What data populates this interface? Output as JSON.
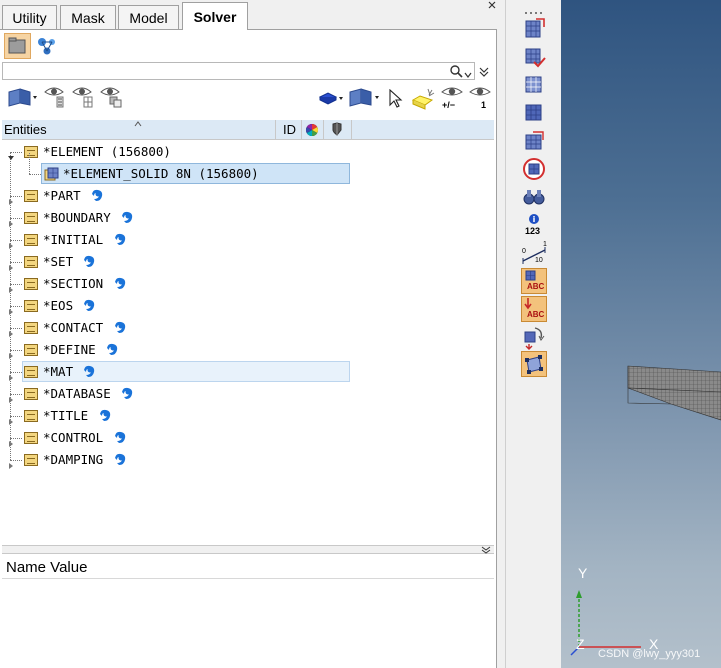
{
  "tabs": [
    {
      "label": "Utility",
      "active": false
    },
    {
      "label": "Mask",
      "active": false
    },
    {
      "label": "Model",
      "active": false
    },
    {
      "label": "Solver",
      "active": true
    }
  ],
  "tree_header": {
    "entities": "Entities",
    "id": "ID"
  },
  "tree": [
    {
      "label": "*ELEMENT (156800)",
      "expanded": true,
      "blob_color": ""
    },
    {
      "label": "*ELEMENT_SOLID 8N (156800)",
      "child": true,
      "selected": true
    },
    {
      "label": "*PART",
      "blob_color": "#1a73d9"
    },
    {
      "label": "*BOUNDARY",
      "blob_color": "#1a73d9"
    },
    {
      "label": "*INITIAL",
      "blob_color": "#1a73d9"
    },
    {
      "label": "*SET",
      "blob_color": "#1a73d9"
    },
    {
      "label": "*SECTION",
      "blob_color": "#1a73d9"
    },
    {
      "label": "*EOS",
      "blob_color": "#1a73d9"
    },
    {
      "label": "*CONTACT",
      "blob_color": "#1a73d9"
    },
    {
      "label": "*DEFINE",
      "blob_color": "#1a73d9"
    },
    {
      "label": "*MAT",
      "blob_color": "#1a73d9",
      "hover": true
    },
    {
      "label": "*DATABASE",
      "blob_color": "#1a73d9"
    },
    {
      "label": "*TITLE",
      "blob_color": "#1a73d9"
    },
    {
      "label": "*CONTROL",
      "blob_color": "#1a73d9"
    },
    {
      "label": "*DAMPING",
      "blob_color": "#1a73d9"
    }
  ],
  "name_value_header": "Name Value",
  "toolbar_icons": [
    "folder-icon",
    "entity-browser-icon",
    "entity-filter-icon",
    "show-eye-icon",
    "isolate-eye-icon",
    "hide-eye-icon",
    "display-mode-icon",
    "element-display-icon",
    "cursor-icon",
    "highlight-icon",
    "show-hide-toggle-eye-icon",
    "show-one-eye-icon"
  ],
  "toolbar_text": {
    "plus_minus": "+/−",
    "one": "1"
  },
  "vstrip_icons": [
    "element-clip-icon",
    "mesh-check-icon",
    "element-quality-icon",
    "mesh-grid-icon",
    "solid-edges-icon",
    "free-edges-icon",
    "binoculars-icon",
    "info-123-icon",
    "ruler-icon",
    "abc-label-icon",
    "abc-arrow-icon",
    "pick-arrow-icon",
    "bounding-box-icon"
  ],
  "vstrip_text": {
    "info": "123",
    "ruler_0": "0",
    "ruler_1": "1",
    "ruler_10": "10",
    "abc": "ABC"
  },
  "axes": {
    "y": "Y",
    "z": "Z",
    "x": "X"
  },
  "watermark": "CSDN @lwy_yyy301",
  "colors": {
    "accent_blue": "#1a73d9",
    "selection": "#cfe4f7",
    "header_bg": "#dce9f5"
  }
}
